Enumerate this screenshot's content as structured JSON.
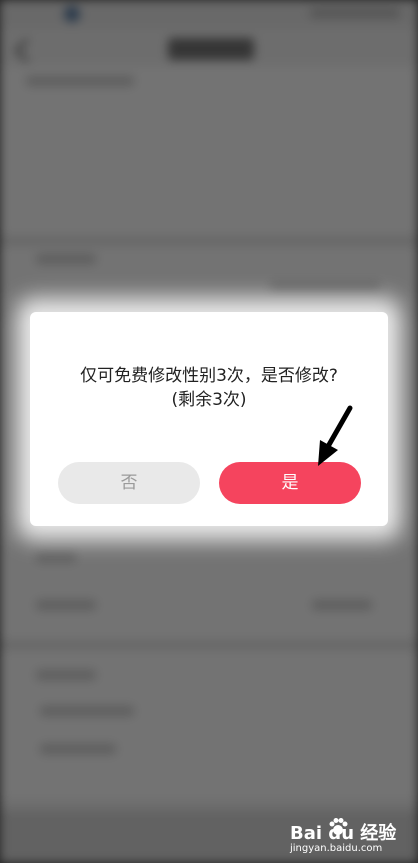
{
  "dialog": {
    "message_line1": "仅可免费修改性别3次，是否修改?",
    "message_line2": "(剩余3次)",
    "no_label": "否",
    "yes_label": "是"
  },
  "watermark": {
    "brand": "Bai du 经验",
    "url": "jingyan.baidu.com"
  },
  "colors": {
    "yes_button": "#f5445e",
    "no_button": "#e9e9e9",
    "overlay": "#4a4a4a"
  },
  "icons": {
    "annotation": "arrow-pointer-icon",
    "watermark_logo": "paw-icon"
  }
}
